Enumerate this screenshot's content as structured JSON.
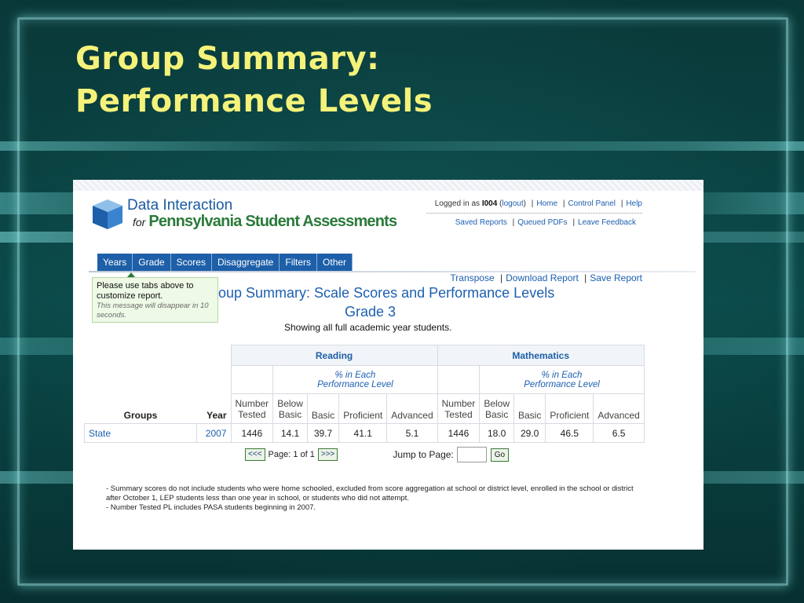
{
  "slide": {
    "title_line1": "Group Summary:",
    "title_line2": "Performance Levels"
  },
  "app": {
    "logo_line1": "Data Interaction",
    "logo_for": "for",
    "logo_line2": "Pennsylvania Student Assessments",
    "logged_in_prefix": "Logged in as",
    "user": "I004",
    "logout": "logout",
    "links": [
      "Home",
      "Control Panel",
      "Help"
    ],
    "sub_links": [
      "Saved Reports",
      "Queued PDFs",
      "Leave Feedback"
    ],
    "tabs": [
      "Years",
      "Grade",
      "Scores",
      "Disaggregate",
      "Filters",
      "Other"
    ],
    "tip_text": "Please use tabs above to customize report.",
    "tip_note": "This message will disappear in 10 seconds.",
    "actions": [
      "Transpose",
      "Download Report",
      "Save Report"
    ]
  },
  "report": {
    "title": "oup Summary: Scale Scores and Performance Levels",
    "grade": "Grade 3",
    "note": "Showing all full academic year students.",
    "subjects": [
      "Reading",
      "Mathematics"
    ],
    "pct_header": "% in Each",
    "pct_header2": "Performance Level",
    "col_groups": "Groups",
    "col_year": "Year",
    "col_number_tested_1": "Number",
    "col_number_tested_2": "Tested",
    "col_below_1": "Below",
    "col_below_2": "Basic",
    "col_basic": "Basic",
    "col_proficient": "Proficient",
    "col_advanced": "Advanced",
    "rows": [
      {
        "group": "State",
        "year": "2007",
        "reading": [
          "1446",
          "14.1",
          "39.7",
          "41.1",
          "5.1"
        ],
        "math": [
          "1446",
          "18.0",
          "29.0",
          "46.5",
          "6.5"
        ]
      }
    ],
    "pager_prev": "<<<",
    "pager_text": "Page: 1 of 1",
    "pager_next": ">>>",
    "jump_label": "Jump to Page:",
    "go_label": "Go",
    "footnote1": "- Summary scores do not include students who were home schooled, excluded from score aggregation at school or district level, enrolled in the school or district after October 1, LEP students less than one year in school, or students who did not attempt.",
    "footnote2": "- Number Tested PL includes PASA students beginning in 2007."
  },
  "colors": {
    "title_yellow": "#f4f27a",
    "tab_blue": "#1d5fa8",
    "link_blue": "#1d5fb0",
    "brand_green": "#2a7a3a"
  }
}
